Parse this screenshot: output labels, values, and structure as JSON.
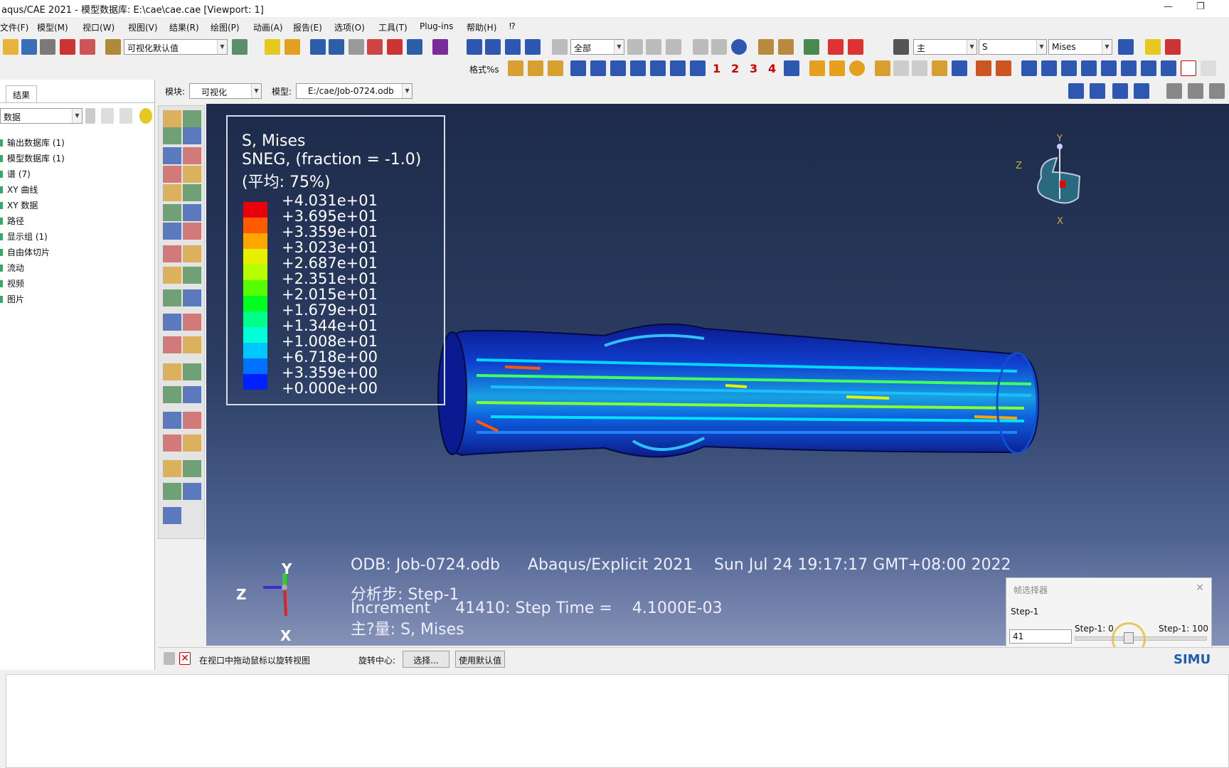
{
  "window": {
    "title": "aqus/CAE 2021 - 模型数据库: E:\\cae\\cae.cae [Viewport: 1]"
  },
  "menus": [
    "文件(F)",
    "模型(M)",
    "视口(W)",
    "视图(V)",
    "结果(R)",
    "绘图(P)",
    "动画(A)",
    "报告(E)",
    "选项(O)",
    "工具(T)",
    "Plug-ins",
    "帮助(H)",
    "⁉"
  ],
  "toolbar": {
    "render_style": "可视化默认值",
    "select_scope": "全部",
    "primary_var": "主",
    "field": "S",
    "invariant": "Mises",
    "format_label": "格式%s",
    "step_numbers": [
      "1",
      "2",
      "3",
      "4"
    ]
  },
  "context": {
    "module_label": "模块:",
    "module_value": "可视化",
    "model_label": "模型:",
    "model_value": "E:/cae/Job-0724.odb"
  },
  "leftpanel": {
    "tab": "结果",
    "filter": "数据",
    "tree": [
      "输出数据库 (1)",
      "模型数据库 (1)",
      "谱 (7)",
      "XY 曲线",
      "XY 数据",
      "路径",
      "显示组 (1)",
      "自由体切片",
      "流动",
      "视频",
      "图片"
    ]
  },
  "legend": {
    "line1": "S, Mises",
    "line2": "SNEG, (fraction = -1.0)",
    "line3": "(平均: 75%)",
    "values": [
      "+4.031e+01",
      "+3.695e+01",
      "+3.359e+01",
      "+3.023e+01",
      "+2.687e+01",
      "+2.351e+01",
      "+2.015e+01",
      "+1.679e+01",
      "+1.344e+01",
      "+1.008e+01",
      "+6.718e+00",
      "+3.359e+00",
      "+0.000e+00"
    ],
    "colors": [
      "#e8000c",
      "#ff5a00",
      "#ffa500",
      "#e6f000",
      "#b6ff00",
      "#56ff00",
      "#00ff20",
      "#00ff88",
      "#00ffd8",
      "#00c8ff",
      "#0070ff",
      "#0020ff"
    ]
  },
  "viewinfo": {
    "odb": "ODB: Job-0724.odb",
    "solver": "Abaqus/Explicit 2021",
    "date": "Sun Jul 24 19:17:17 GMT+08:00 2022",
    "step": "分析步: Step-1",
    "increment": "Increment     41410: Step Time =    4.1000E-03",
    "primary": "主?量: S, Mises"
  },
  "triad": {
    "y": "Y",
    "z": "Z",
    "x": "X"
  },
  "frame_selector": {
    "title": "帧选择器",
    "step": "Step-1",
    "frame_value": "41",
    "min_label": "Step-1: 0",
    "max_label": "Step-1: 100",
    "fraction": 0.41
  },
  "status": {
    "prompt": "在视口中拖动鼠标以旋转视图",
    "center_label": "旋转中心:",
    "select_btn": "选择...",
    "default_btn": "使用默认值"
  },
  "logo": "SIMU"
}
